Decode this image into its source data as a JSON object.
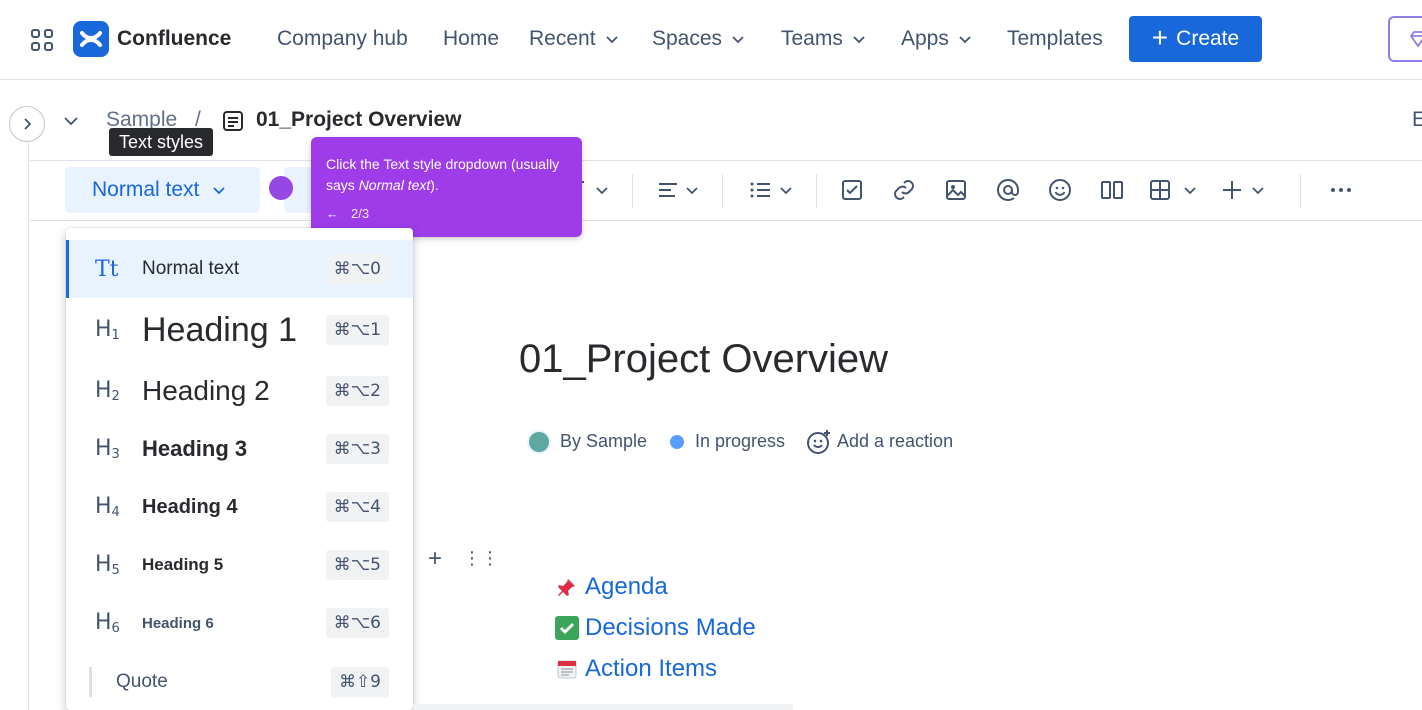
{
  "topnav": {
    "logo_text": "Confluence",
    "items": [
      {
        "label": "Company hub"
      },
      {
        "label": "Home"
      },
      {
        "label": "Recent"
      },
      {
        "label": "Spaces"
      },
      {
        "label": "Teams"
      },
      {
        "label": "Apps"
      },
      {
        "label": "Templates"
      }
    ],
    "create_label": "Create",
    "accent": "#1868db"
  },
  "breadcrumb": {
    "space": "Sample",
    "separator": "/",
    "page": "01_Project Overview",
    "edge_text": "E"
  },
  "tooltip": {
    "text": "Text styles"
  },
  "toolbar": {
    "text_style_label": "Normal text",
    "icons": [
      "text-color-icon",
      "alignment-icon",
      "list-icon",
      "task-icon",
      "link-icon",
      "image-icon",
      "mention-icon",
      "emoji-icon",
      "layouts-icon",
      "table-icon",
      "insert-icon",
      "more-icon"
    ]
  },
  "guide": {
    "text_before": "Click the Text style dropdown (usually says ",
    "text_em": "Normal text",
    "text_after": ").",
    "step": "2/3",
    "color": "#9d3ce8"
  },
  "dropdown": {
    "items": [
      {
        "icon": "Tt",
        "label": "Normal text",
        "shortcut": "⌘⌥0"
      },
      {
        "icon": "H1",
        "label": "Heading 1",
        "shortcut": "⌘⌥1"
      },
      {
        "icon": "H2",
        "label": "Heading 2",
        "shortcut": "⌘⌥2"
      },
      {
        "icon": "H3",
        "label": "Heading 3",
        "shortcut": "⌘⌥3"
      },
      {
        "icon": "H4",
        "label": "Heading 4",
        "shortcut": "⌘⌥4"
      },
      {
        "icon": "H5",
        "label": "Heading 5",
        "shortcut": "⌘⌥5"
      },
      {
        "icon": "H6",
        "label": "Heading 6",
        "shortcut": "⌘⌥6"
      },
      {
        "icon": "quote",
        "label": "Quote",
        "shortcut": "⌘⇧9"
      }
    ]
  },
  "page": {
    "title": "01_Project Overview",
    "byline": "By Sample",
    "status": "In progress",
    "reaction": "Add a reaction",
    "toc": [
      {
        "emoji": "pushpin-icon",
        "label": "Agenda"
      },
      {
        "emoji": "check-mark-icon",
        "label": "Decisions Made"
      },
      {
        "emoji": "calendar-icon",
        "label": "Action Items"
      }
    ]
  }
}
